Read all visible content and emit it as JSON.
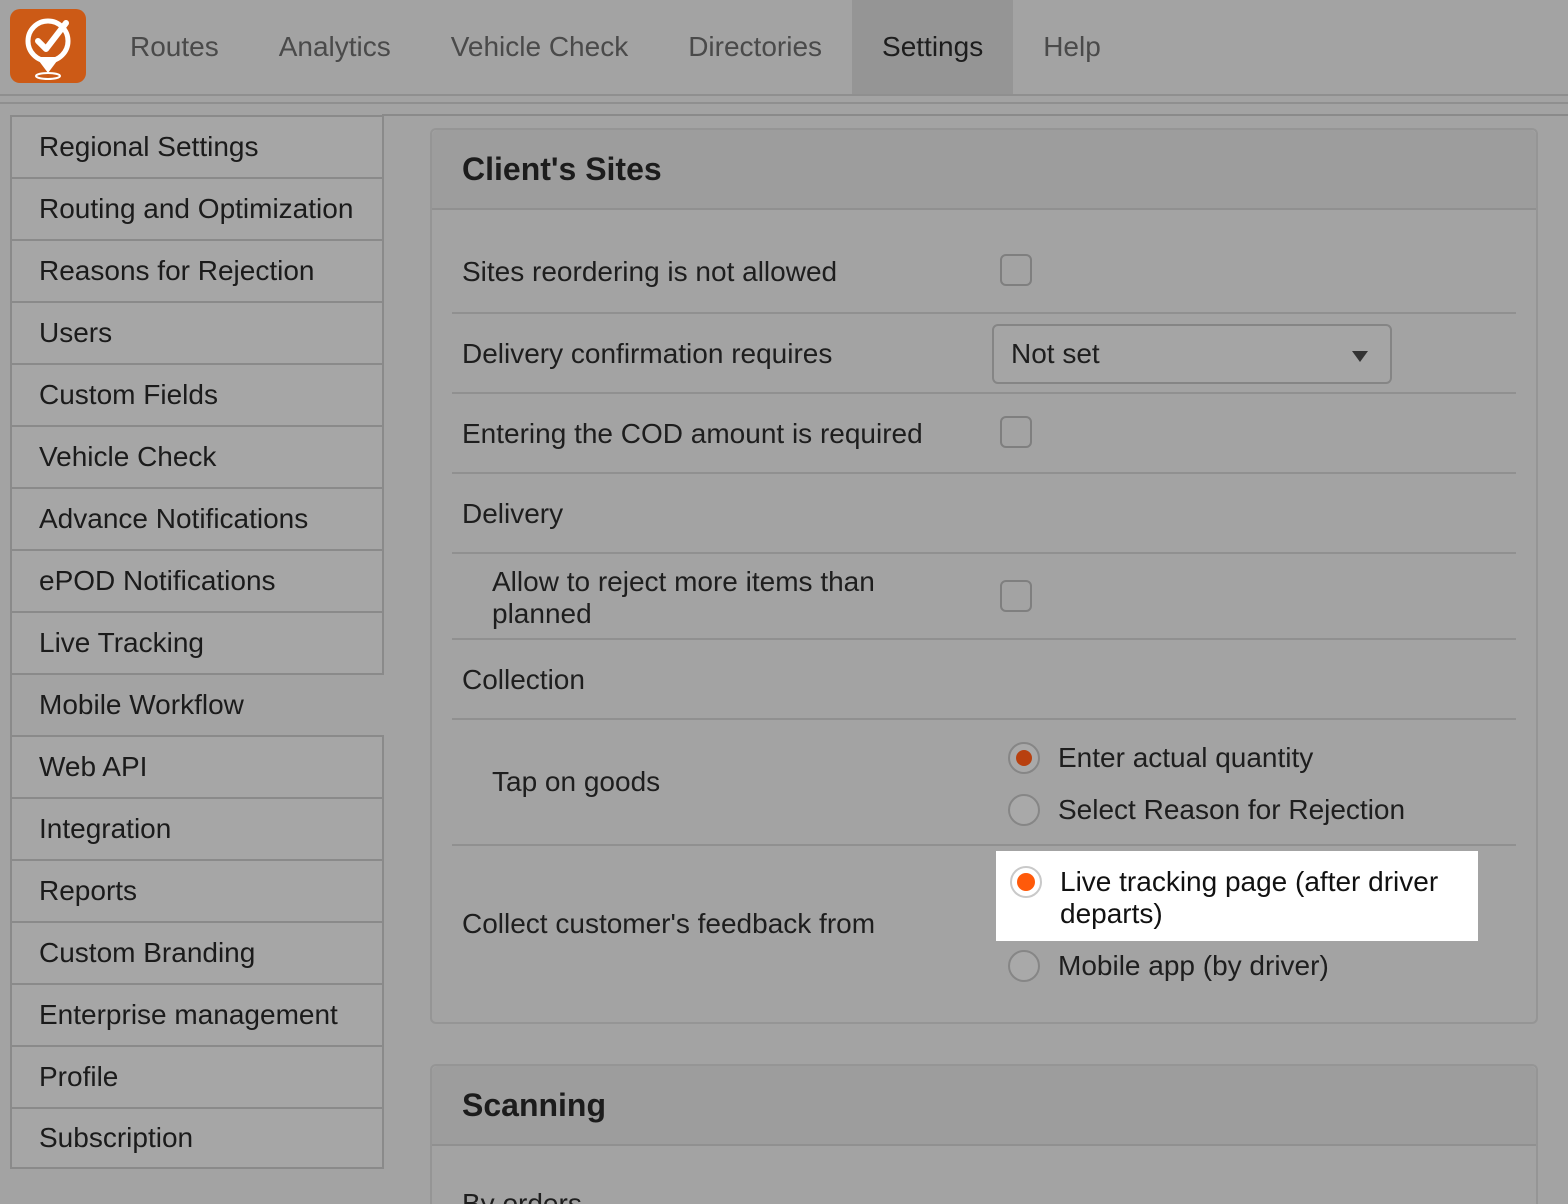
{
  "brand": {
    "accent": "#cc5a16",
    "highlight_dot": "#ff5a0a"
  },
  "logo": {
    "icon": "location-check-icon"
  },
  "nav": [
    {
      "label": "Routes"
    },
    {
      "label": "Analytics"
    },
    {
      "label": "Vehicle Check"
    },
    {
      "label": "Directories"
    },
    {
      "label": "Settings",
      "active": true
    },
    {
      "label": "Help"
    }
  ],
  "sidebar": {
    "items": [
      {
        "label": "Regional Settings"
      },
      {
        "label": "Routing and Optimization"
      },
      {
        "label": "Reasons for Rejection"
      },
      {
        "label": "Users"
      },
      {
        "label": "Custom Fields"
      },
      {
        "label": "Vehicle Check"
      },
      {
        "label": "Advance Notifications"
      },
      {
        "label": "ePOD Notifications"
      },
      {
        "label": "Live Tracking"
      },
      {
        "label": "Mobile Workflow",
        "active": true
      },
      {
        "label": "Web API"
      },
      {
        "label": "Integration"
      },
      {
        "label": "Reports"
      },
      {
        "label": "Custom Branding"
      },
      {
        "label": "Enterprise management"
      },
      {
        "label": "Profile"
      },
      {
        "label": "Subscription"
      }
    ]
  },
  "clients_sites": {
    "title": "Client's Sites",
    "reorder": {
      "label": "Sites reordering is not allowed",
      "checked": false
    },
    "confirmation": {
      "label": "Delivery confirmation requires",
      "value": "Not set"
    },
    "cod": {
      "label": "Entering the COD amount is required",
      "checked": false
    },
    "delivery": {
      "label": "Delivery"
    },
    "reject_more": {
      "label": "Allow to reject more items than planned",
      "checked": false
    },
    "collection": {
      "label": "Collection"
    },
    "tap_goods": {
      "label": "Tap on goods",
      "options": [
        "Enter actual quantity",
        "Select Reason for Rejection"
      ],
      "selected": "Enter actual quantity"
    },
    "feedback": {
      "label": "Collect customer's feedback from",
      "options": [
        "Live tracking page (after driver departs)",
        "Mobile app (by driver)"
      ],
      "selected": "Live tracking page (after driver departs)"
    }
  },
  "scanning": {
    "title": "Scanning",
    "first_row_label": "By orders"
  }
}
